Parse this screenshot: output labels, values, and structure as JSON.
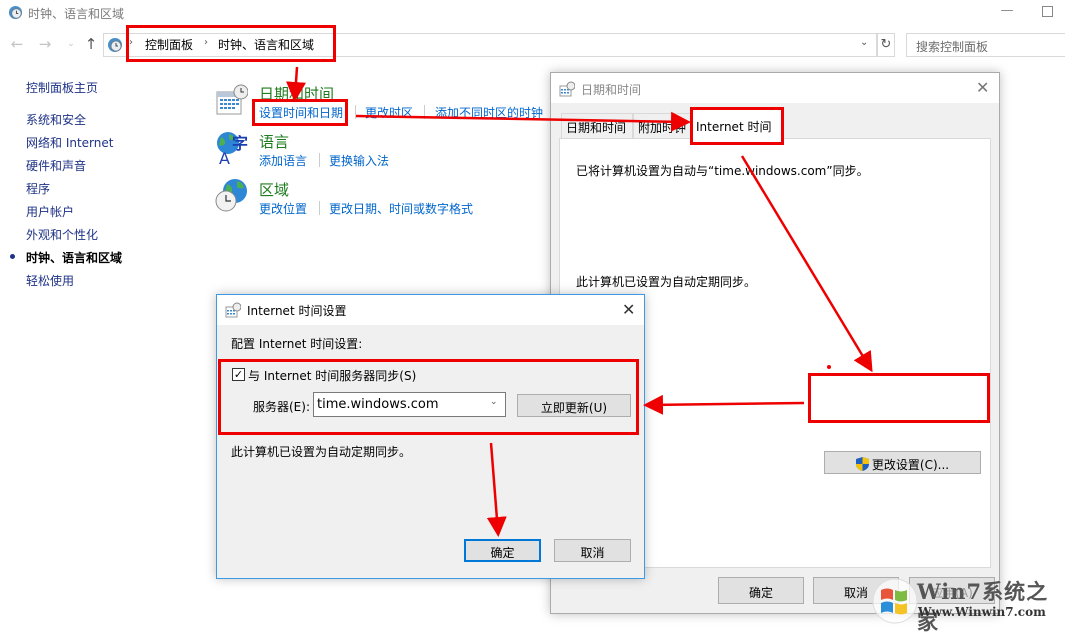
{
  "window": {
    "title": "时钟、语言和区域",
    "minimize_glyph": "—"
  },
  "navbar": {
    "back_glyph": "←",
    "forward_glyph": "→",
    "recent_glyph": "⌄",
    "up_glyph": "↑",
    "breadcrumb": [
      "控制面板",
      "时钟、语言和区域"
    ],
    "breadcrumb_sep": "›",
    "dropdown_glyph": "⌄",
    "refresh_glyph": "↻",
    "search_placeholder": "搜索控制面板"
  },
  "sidebar": {
    "home": "控制面板主页",
    "items": [
      {
        "label": "系统和安全",
        "active": false
      },
      {
        "label": "网络和 Internet",
        "active": false
      },
      {
        "label": "硬件和声音",
        "active": false
      },
      {
        "label": "程序",
        "active": false
      },
      {
        "label": "用户帐户",
        "active": false
      },
      {
        "label": "外观和个性化",
        "active": false
      },
      {
        "label": "时钟、语言和区域",
        "active": true
      },
      {
        "label": "轻松使用",
        "active": false
      }
    ]
  },
  "categories": [
    {
      "title": "日期和时间",
      "icon": "calendar-clock-icon",
      "links": [
        "设置时间和日期",
        "更改时区",
        "添加不同时区的时钟"
      ]
    },
    {
      "title": "语言",
      "icon": "language-globe-icon",
      "links": [
        "添加语言",
        "更换输入法"
      ]
    },
    {
      "title": "区域",
      "icon": "region-globe-clock-icon",
      "links": [
        "更改位置",
        "更改日期、时间或数字格式"
      ]
    }
  ],
  "datetime_dialog": {
    "title": "日期和时间",
    "close_glyph": "✕",
    "tabs": [
      {
        "label": "日期和时间",
        "active": false
      },
      {
        "label": "附加时钟",
        "active": false
      },
      {
        "label": "Internet 时间",
        "active": true
      }
    ],
    "sync_status": "已将计算机设置为自动与“time.windows.com”同步。",
    "auto_sync_text": "此计算机已设置为自动定期同步。",
    "change_settings_label": "更改设置(C)...",
    "ok_label": "确定",
    "cancel_label": "取消",
    "apply_label": "应用(A)"
  },
  "internet_time_dialog": {
    "title": "Internet 时间设置",
    "close_glyph": "✕",
    "heading": "配置 Internet 时间设置:",
    "sync_checkbox_label": "与 Internet 时间服务器同步(S)",
    "sync_checked": true,
    "check_glyph": "✓",
    "server_label": "服务器(E):",
    "server_value": "time.windows.com",
    "server_chevron": "⌄",
    "update_now_label": "立即更新(U)",
    "auto_sync_text": "此计算机已设置为自动定期同步。",
    "ok_label": "确定",
    "cancel_label": "取消"
  },
  "watermark": {
    "text": "Win7系统之家",
    "url": "Www.Winwin7.com"
  },
  "annotations": {
    "color": "#ee0000"
  }
}
